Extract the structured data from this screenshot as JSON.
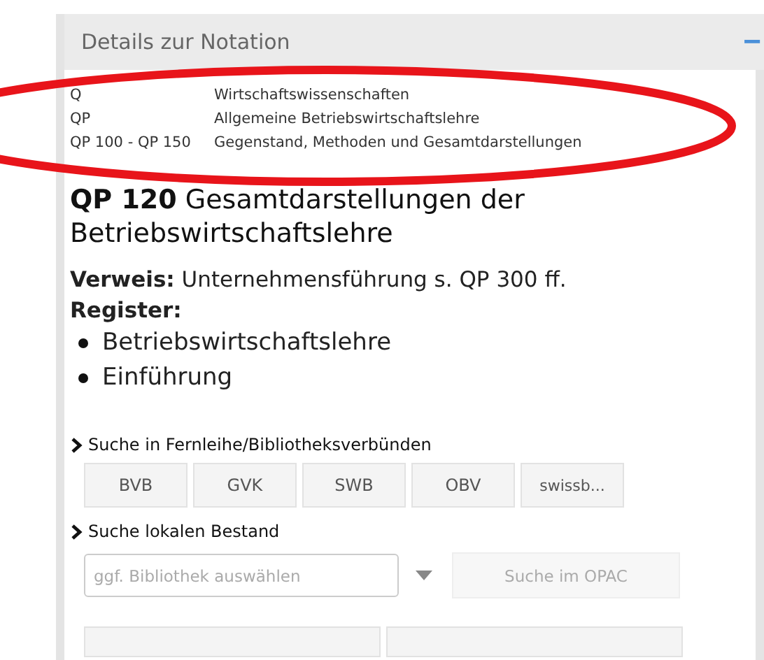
{
  "panel": {
    "title": "Details zur Notation",
    "collapse_symbol": "−"
  },
  "hierarchy": [
    {
      "notation": "Q",
      "label": "Wirtschaftswissenschaften"
    },
    {
      "notation": "QP",
      "label": "Allgemeine Betriebswirtschaftslehre"
    },
    {
      "notation": "QP 100 - QP 150",
      "label": "Gegenstand, Methoden und Gesamtdarstellungen"
    }
  ],
  "heading": "**QP 120** Gesamtdarstellungen der Betriebswirtschaftslehre",
  "reference": "**Verweis:** Unternehmensführung s. QP 300 ff.",
  "register": {
    "label": "Register:",
    "items": [
      "Betriebswirtschaftslehre",
      "Einführung"
    ]
  },
  "remote_search": {
    "label": "Suche in Fernleihe/Bibliotheksverbünden",
    "buttons": [
      "BVB",
      "GVK",
      "SWB",
      "OBV",
      "swissb..."
    ]
  },
  "local_search": {
    "label": "Suche lokalen Bestand",
    "select_placeholder": "ggf. Bibliothek auswählen",
    "button": "Suche im OPAC",
    "button_disabled": true
  }
}
